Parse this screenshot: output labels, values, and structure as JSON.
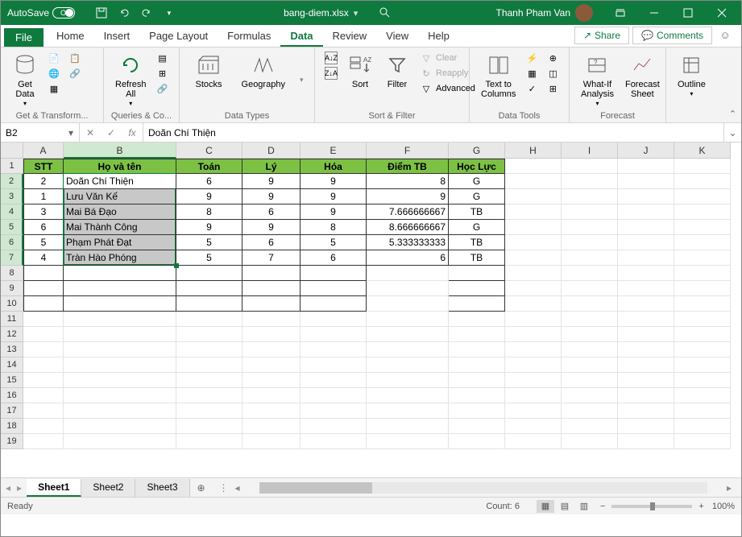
{
  "titlebar": {
    "autosave_label": "AutoSave",
    "autosave_state": "Off",
    "filename": "bang-diem.xlsx",
    "saved_indicator": "▾",
    "username": "Thanh Pham Van"
  },
  "tabs": {
    "file": "File",
    "items": [
      "Home",
      "Insert",
      "Page Layout",
      "Formulas",
      "Data",
      "Review",
      "View",
      "Help"
    ],
    "active": "Data",
    "share": "Share",
    "comments": "Comments"
  },
  "ribbon": {
    "groups": {
      "get_transform": {
        "label": "Get & Transform...",
        "get_data": "Get\nData"
      },
      "queries": {
        "label": "Queries & Co...",
        "refresh_all": "Refresh\nAll"
      },
      "data_types": {
        "label": "Data Types",
        "stocks": "Stocks",
        "geography": "Geography"
      },
      "sort_filter": {
        "label": "Sort & Filter",
        "sort": "Sort",
        "filter": "Filter",
        "clear": "Clear",
        "reapply": "Reapply",
        "advanced": "Advanced"
      },
      "data_tools": {
        "label": "Data Tools",
        "text_to_cols": "Text to\nColumns"
      },
      "forecast": {
        "label": "Forecast",
        "whatif": "What-If\nAnalysis",
        "forecast_sheet": "Forecast\nSheet"
      },
      "outline": {
        "label": "",
        "outline": "Outline"
      }
    }
  },
  "formula_bar": {
    "name_box": "B2",
    "formula": "Doãn Chí Thiện"
  },
  "grid": {
    "columns": [
      {
        "letter": "A",
        "width": 50
      },
      {
        "letter": "B",
        "width": 140
      },
      {
        "letter": "C",
        "width": 82
      },
      {
        "letter": "D",
        "width": 72
      },
      {
        "letter": "E",
        "width": 82
      },
      {
        "letter": "F",
        "width": 102
      },
      {
        "letter": "G",
        "width": 70
      },
      {
        "letter": "H",
        "width": 70
      },
      {
        "letter": "I",
        "width": 70
      },
      {
        "letter": "J",
        "width": 70
      },
      {
        "letter": "K",
        "width": 70
      }
    ],
    "headers": [
      "STT",
      "Họ và tên",
      "Toán",
      "Lý",
      "Hóa",
      "Điểm TB",
      "Học Lực"
    ],
    "rows": [
      {
        "stt": "2",
        "name": "Doãn Chí Thiện",
        "toan": "6",
        "ly": "9",
        "hoa": "9",
        "tb": "8",
        "hl": "G"
      },
      {
        "stt": "1",
        "name": "Lưu Văn Kế",
        "toan": "9",
        "ly": "9",
        "hoa": "9",
        "tb": "9",
        "hl": "G"
      },
      {
        "stt": "3",
        "name": "Mai Bá Đạo",
        "toan": "8",
        "ly": "6",
        "hoa": "9",
        "tb": "7.666666667",
        "hl": "TB"
      },
      {
        "stt": "6",
        "name": "Mai Thành Công",
        "toan": "9",
        "ly": "9",
        "hoa": "8",
        "tb": "8.666666667",
        "hl": "G"
      },
      {
        "stt": "5",
        "name": "Phạm Phát Đạt",
        "toan": "5",
        "ly": "6",
        "hoa": "5",
        "tb": "5.333333333",
        "hl": "TB"
      },
      {
        "stt": "4",
        "name": "Tràn Hào Phóng",
        "toan": "5",
        "ly": "7",
        "hoa": "6",
        "tb": "6",
        "hl": "TB"
      }
    ],
    "total_rows": 19
  },
  "sheets": {
    "items": [
      "Sheet1",
      "Sheet2",
      "Sheet3"
    ],
    "active": "Sheet1"
  },
  "status": {
    "ready": "Ready",
    "count_label": "Count:",
    "count_value": "6",
    "zoom": "100%"
  }
}
